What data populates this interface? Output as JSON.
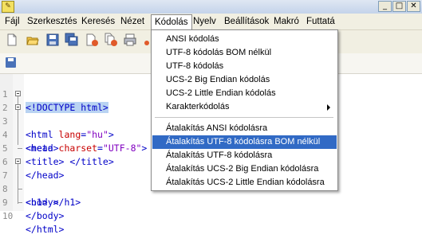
{
  "menubar": {
    "items": [
      "Fájl",
      "Szerkesztés",
      "Keresés",
      "Nézet",
      "Kódolás",
      "Nyelv",
      "Beállítások",
      "Makró",
      "Futtatá"
    ]
  },
  "window_buttons": {
    "minimize": "_",
    "maximize": "□",
    "close": "✕"
  },
  "encoding_menu": {
    "items": [
      "ANSI kódolás",
      "UTF-8 kódolás BOM nélkül",
      "UTF-8 kódolás",
      "UCS-2 Big Endian kódolás",
      "UCS-2 Little Endian kódolás",
      "Karakterkódolás",
      "Átalakítás ANSI kódolásra",
      "Átalakítás UTF-8 kódolásra BOM nélkül",
      "Átalakítás UTF-8 kódolásra",
      "Átalakítás UCS-2 Big Endian kódolásra",
      "Átalakítás UCS-2 Little Endian kódolásra"
    ],
    "highlighted": "Átalakítás UTF-8 kódolásra BOM nélkül"
  },
  "editor": {
    "line_numbers": [
      "1",
      "2",
      "3",
      "4",
      "5",
      "6",
      "7",
      "8",
      "9",
      "10"
    ],
    "lines": [
      "<!DOCTYPE html>",
      "<html lang=\"hu\">",
      "<head>",
      "<meta charset=\"UTF-8\">",
      "<title> </title>",
      "</head>",
      "<body>",
      "<h1> </h1>",
      "</body>",
      "</html>"
    ]
  },
  "colors": {
    "tag": "#0000c8",
    "attribute": "#c80000",
    "value": "#8000c0",
    "menu_highlight": "#316ac5",
    "selection": "#b9d3f2"
  }
}
